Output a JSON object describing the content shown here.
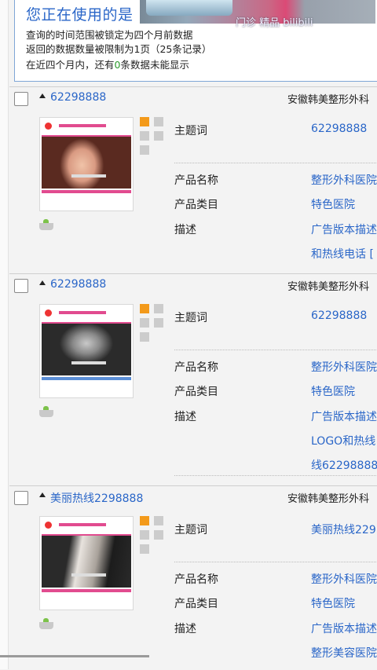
{
  "notice": {
    "title": "您正在使用的是",
    "line1": "查询的时间范围被锁定为四个月前数据",
    "line2": "返回的数据数量被限制为1页（25条记录）",
    "line3_prefix": "在近四个月内，还有",
    "line3_count": "0",
    "line3_suffix": "条数据未能显示"
  },
  "watermark": "门诊 精品 bilibili",
  "records": [
    {
      "keyword_link": "62298888",
      "company": "安徽韩美整形外科",
      "fields": {
        "keyword_label": "主题词",
        "keyword_value": "62298888",
        "product_name_label": "产品名称",
        "product_name_value": "整形外科医院",
        "category_label": "产品类目",
        "category_value": "特色医院",
        "desc_label": "描述",
        "desc_lines": [
          "广告版本描述",
          "和热线电话 ["
        ]
      }
    },
    {
      "keyword_link": "62298888",
      "company": "安徽韩美整形外科",
      "fields": {
        "keyword_label": "主题词",
        "keyword_value": "62298888",
        "product_name_label": "产品名称",
        "product_name_value": "整形外科医院",
        "category_label": "产品类目",
        "category_value": "特色医院",
        "desc_label": "描述",
        "desc_lines": [
          "广告版本描述",
          "LOGO和热线",
          "线62298888"
        ]
      }
    },
    {
      "keyword_link": "美丽热线2298888",
      "company": "安徽韩美整形外科",
      "fields": {
        "keyword_label": "主题词",
        "keyword_value": "美丽热线229",
        "product_name_label": "产品名称",
        "product_name_value": "整形外科医院",
        "category_label": "产品类目",
        "category_value": "特色医院",
        "desc_label": "描述",
        "desc_lines": [
          "广告版本描述",
          "整形美容医院"
        ]
      }
    }
  ],
  "colors": {
    "link": "#2a66c8",
    "accent_orange": "#f39a1b",
    "count_green": "#2e9b2e",
    "brand_pink": "#e14b8f"
  },
  "icons": {
    "expand": "arrow-up-icon",
    "basket": "basket-icon",
    "swatch": "color-swatch-icon"
  }
}
